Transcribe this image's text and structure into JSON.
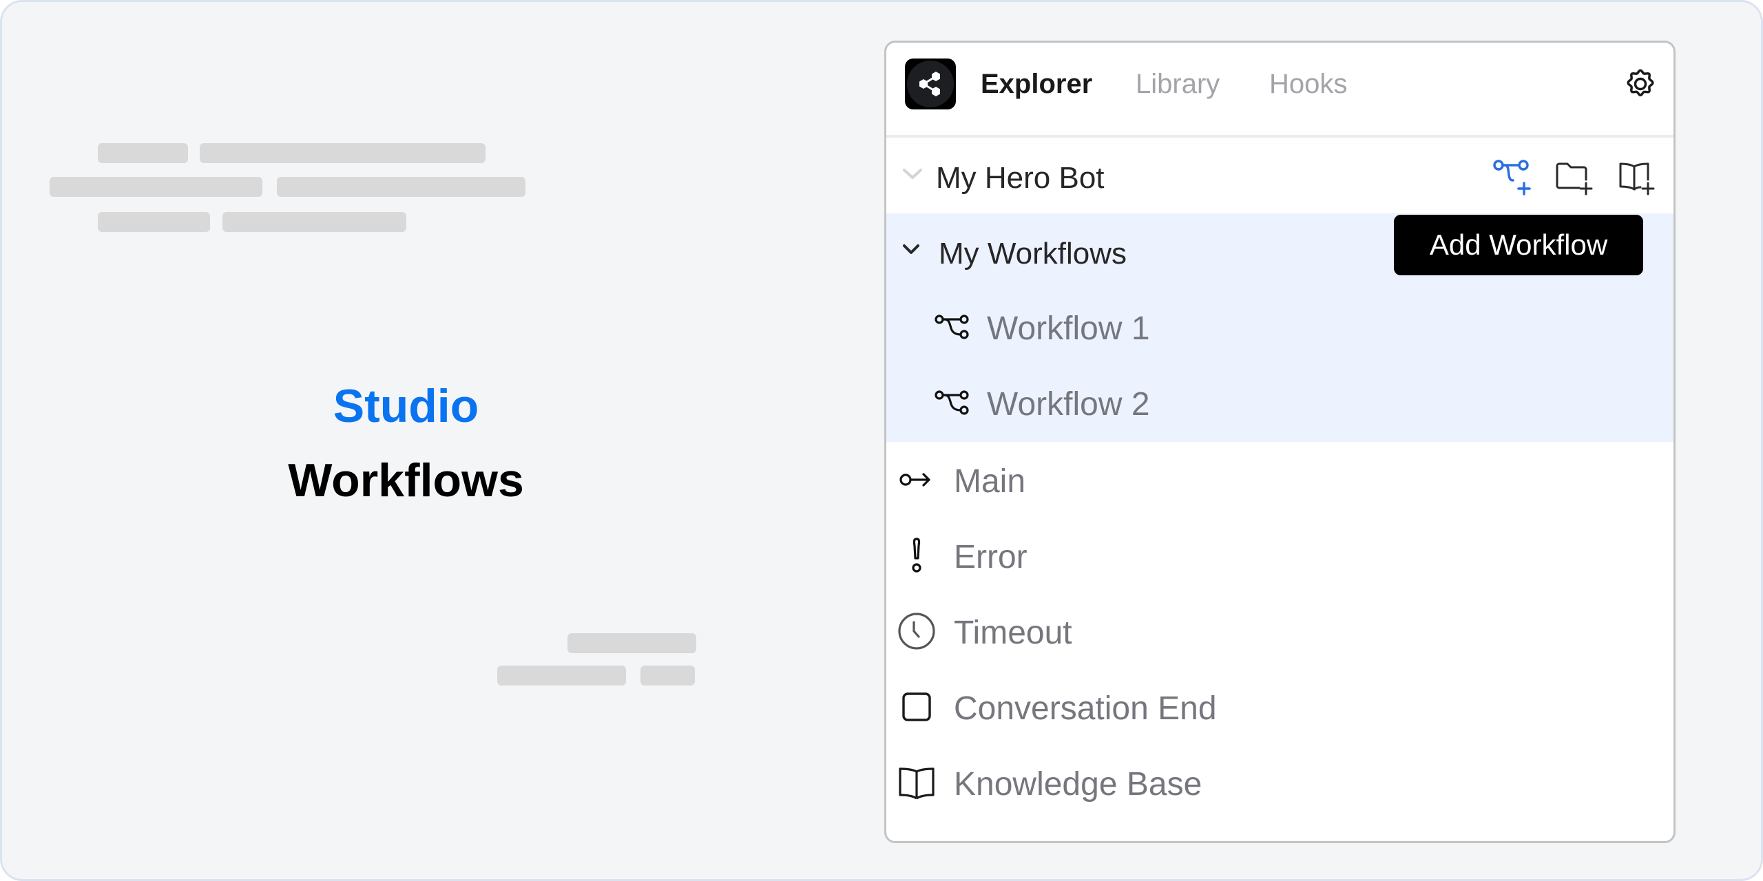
{
  "hero": {
    "brand": "Studio",
    "title": "Workflows",
    "brand_color": "#0a74f0"
  },
  "panel": {
    "tabs": [
      {
        "label": "Explorer",
        "active": true
      },
      {
        "label": "Library",
        "active": false
      },
      {
        "label": "Hooks",
        "active": false
      }
    ],
    "icons": {
      "logo": "share-nodes-icon",
      "settings": "gear-icon"
    },
    "bot": {
      "name": "My Hero Bot",
      "actions": [
        {
          "icon": "add-workflow-icon",
          "label": "Add Workflow",
          "color": "#2a6fe0"
        },
        {
          "icon": "add-folder-icon",
          "label": "Add Folder"
        },
        {
          "icon": "add-knowledge-base-icon",
          "label": "Add Knowledge Base"
        }
      ]
    },
    "group": {
      "name": "My Workflows",
      "tooltip": "Add Workflow",
      "items": [
        {
          "label": "Workflow 1",
          "icon": "workflow-icon"
        },
        {
          "label": "Workflow 2",
          "icon": "workflow-icon"
        }
      ]
    },
    "items": [
      {
        "label": "Main",
        "icon": "entry-arrow-icon"
      },
      {
        "label": "Error",
        "icon": "exclamation-icon"
      },
      {
        "label": "Timeout",
        "icon": "clock-icon"
      },
      {
        "label": "Conversation End",
        "icon": "square-icon"
      },
      {
        "label": "Knowledge Base",
        "icon": "book-icon"
      }
    ]
  }
}
